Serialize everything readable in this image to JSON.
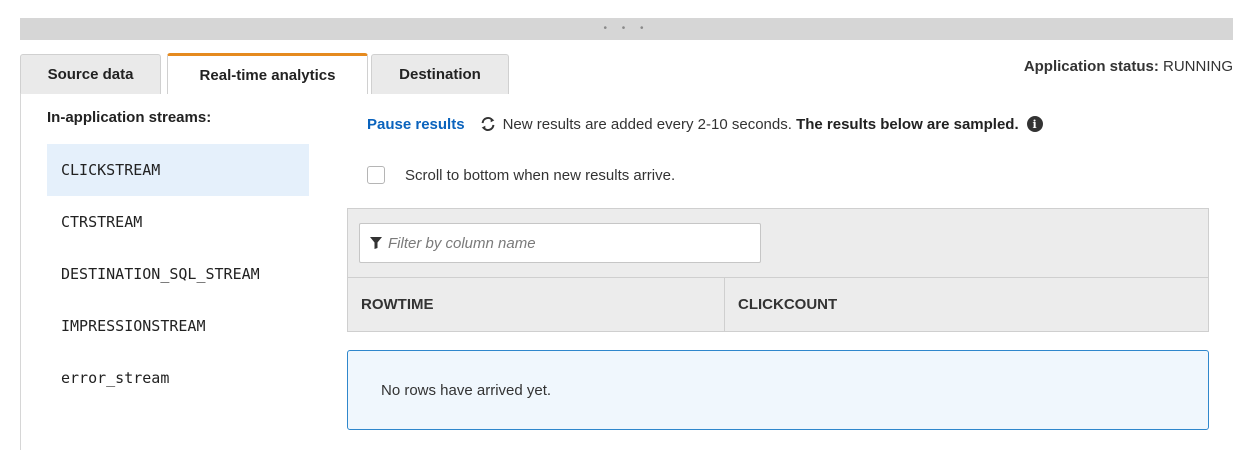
{
  "window": {
    "drag_dots": "• • •"
  },
  "tabs": [
    {
      "label": "Source data"
    },
    {
      "label": "Real-time analytics"
    },
    {
      "label": "Destination"
    }
  ],
  "status": {
    "label": "Application status:",
    "value": "RUNNING"
  },
  "streams": {
    "title": "In-application streams:",
    "items": [
      {
        "label": "CLICKSTREAM"
      },
      {
        "label": "CTRSTREAM"
      },
      {
        "label": "DESTINATION_SQL_STREAM"
      },
      {
        "label": "IMPRESSIONSTREAM"
      },
      {
        "label": "error_stream"
      }
    ]
  },
  "toolbar": {
    "pause_label": "Pause results",
    "refresh_message": "New results are added every 2-10 seconds.",
    "sampled_message": "The results below are sampled."
  },
  "scroll_option": {
    "label": "Scroll to bottom when new results arrive."
  },
  "filter": {
    "placeholder": "Filter by column name"
  },
  "table": {
    "columns": [
      "ROWTIME",
      "CLICKCOUNT"
    ]
  },
  "empty_message": "No rows have arrived yet.",
  "colors": {
    "accent_tab": "#e58a1f",
    "link": "#0a63bd",
    "selected_bg": "#e5f0fb",
    "info_border": "#2f87cc"
  }
}
